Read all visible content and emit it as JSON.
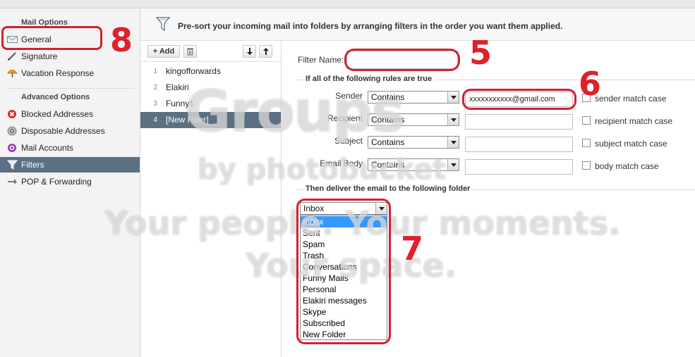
{
  "sidebar": {
    "mail_options_title": "Mail Options",
    "mail_items": [
      {
        "label": "General",
        "icon": "envelope-icon"
      },
      {
        "label": "Signature",
        "icon": "pen-icon"
      },
      {
        "label": "Vacation Response",
        "icon": "beach-umbrella-icon"
      }
    ],
    "advanced_title": "Advanced Options",
    "advanced_items": [
      {
        "label": "Blocked Addresses",
        "icon": "blocked-icon"
      },
      {
        "label": "Disposable Addresses",
        "icon": "disposable-icon"
      },
      {
        "label": "Mail Accounts",
        "icon": "mail-accounts-icon"
      },
      {
        "label": "Filters",
        "icon": "funnel-icon",
        "active": true
      },
      {
        "label": "POP & Forwarding",
        "icon": "forward-arrow-icon"
      }
    ]
  },
  "header": {
    "description": "Pre-sort your incoming mail into folders by arranging filters in the order you want them applied."
  },
  "filter_list": {
    "add_label": "+ Add",
    "filters": [
      {
        "num": "1",
        "name": "kingofforwards"
      },
      {
        "num": "2",
        "name": "Elakiri"
      },
      {
        "num": "3",
        "name": "Funny1"
      },
      {
        "num": "4",
        "name": "[New Filter]",
        "selected": true
      }
    ]
  },
  "form": {
    "filter_name_label": "Filter Name:",
    "filter_name_value": "",
    "rules_title": "If all of the following rules are true",
    "rules": [
      {
        "label": "Sender",
        "operator": "Contains",
        "value": "xxxxxxxxxxx@gmail.com",
        "match_case_label": "sender match case"
      },
      {
        "label": "Recipient",
        "operator": "Contains",
        "value": "",
        "match_case_label": "recipient match case"
      },
      {
        "label": "Subject",
        "operator": "Contains",
        "value": "",
        "match_case_label": "subject match case"
      },
      {
        "label": "Email Body",
        "operator": "Contains",
        "value": "",
        "match_case_label": "body match case"
      }
    ],
    "deliver_title": "Then deliver the email to the following folder",
    "folder_selected": "Inbox",
    "folder_options": [
      "Inbox",
      "Sent",
      "Spam",
      "Trash",
      "Conversations",
      "Funny Mails",
      "Personal",
      "Elakiri messages",
      "Skype",
      "Subscribed",
      "New Folder"
    ]
  },
  "watermark": {
    "brand": "Groups",
    "byline": "by photobucket",
    "tagline_1": "Your people. Your moments.",
    "tagline_2": "Your space."
  },
  "annotations": {
    "a5": "5",
    "a6": "6",
    "a7": "7",
    "a8": "8"
  },
  "colors": {
    "active_row": "#5b7083",
    "annotation_red": "#d42030",
    "dropdown_highlight": "#3399ff"
  }
}
